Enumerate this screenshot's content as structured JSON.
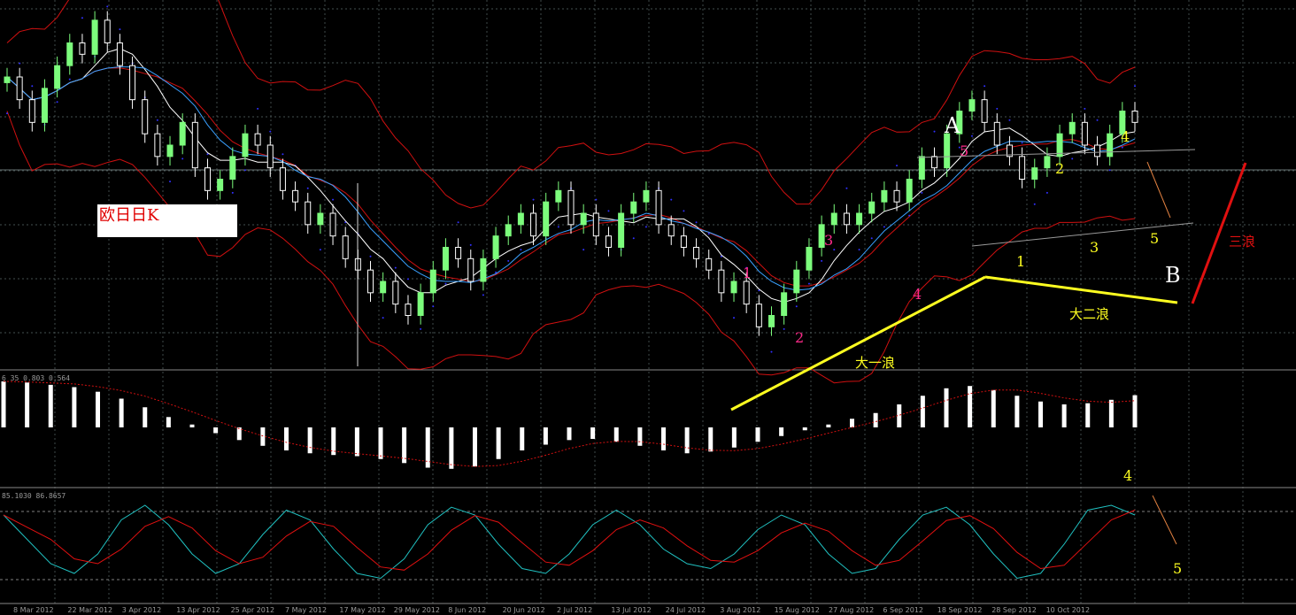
{
  "title_box": "欧日日K",
  "panels": {
    "macd_header": "6 35 0.803 0.564",
    "stoch_header": "85.1030 86.8657"
  },
  "x_dates": [
    "8 Mar 2012",
    "22 Mar 2012",
    "3 Apr 2012",
    "13 Apr 2012",
    "25 Apr 2012",
    "7 May 2012",
    "17 May 2012",
    "29 May 2012",
    "8 Jun 2012",
    "20 Jun 2012",
    "2 Jul 2012",
    "13 Jul 2012",
    "24 Jul 2012",
    "3 Aug 2012",
    "15 Aug 2012",
    "27 Aug 2012",
    "6 Sep 2012",
    "18 Sep 2012",
    "28 Sep 2012",
    "10 Oct 2012"
  ],
  "annotations": {
    "wave_A": "A",
    "wave_B": "B",
    "wave_three": "三浪",
    "big_wave_one": "大一浪",
    "big_wave_two": "大二浪",
    "pink_counts": [
      "1",
      "2",
      "3",
      "4",
      "5"
    ],
    "yellow_counts": [
      "1",
      "2",
      "3",
      "4",
      "5"
    ],
    "stoch_counts": [
      "4",
      "5"
    ]
  },
  "colors": {
    "background": "#000000",
    "grid": "#5a6a6a",
    "candle_bull": "#7cfc7c",
    "candle_bear": "#ffffff",
    "bollinger": "#d01010",
    "sar_dots": "#3030ff",
    "ma_white": "#ffffff",
    "ma_blue": "#3aa0ff",
    "macd_bars": "#ffffff",
    "macd_signal": "#d01010",
    "stoch_main": "#20c0c0",
    "stoch_signal": "#e01010",
    "pink": "#ff2a8a",
    "yellow": "#ffff20",
    "wave_red": "#e01010"
  },
  "chart_data": {
    "type": "candlestick",
    "title": "欧日日K",
    "series": [
      {
        "name": "price",
        "values": [
          108,
          106,
          104,
          107,
          109,
          111,
          110,
          113,
          111,
          109,
          106,
          103,
          101,
          102,
          104,
          100,
          98,
          99,
          101,
          103,
          102,
          100,
          98,
          97,
          95,
          96,
          94,
          92,
          91,
          89,
          90,
          88,
          87,
          89,
          91,
          93,
          92,
          90,
          92,
          94,
          95,
          96,
          94,
          97,
          98,
          95,
          96,
          94,
          93,
          96,
          97,
          98,
          95,
          94,
          93,
          92,
          91,
          89,
          90,
          88,
          86,
          87,
          89,
          91,
          93,
          95,
          96,
          95,
          96,
          97,
          98,
          97,
          99,
          101,
          100,
          103,
          105,
          106,
          104,
          102,
          101,
          99,
          100,
          101,
          103,
          104,
          102,
          101,
          103,
          105,
          104
        ]
      }
    ],
    "macd_values": [
      0.8,
      0.78,
      0.74,
      0.7,
      0.62,
      0.5,
      0.35,
      0.18,
      0.05,
      -0.1,
      -0.22,
      -0.32,
      -0.4,
      -0.45,
      -0.48,
      -0.5,
      -0.55,
      -0.62,
      -0.7,
      -0.72,
      -0.68,
      -0.55,
      -0.4,
      -0.3,
      -0.22,
      -0.2,
      -0.25,
      -0.32,
      -0.4,
      -0.45,
      -0.42,
      -0.35,
      -0.25,
      -0.15,
      -0.05,
      0.05,
      0.15,
      0.25,
      0.4,
      0.55,
      0.68,
      0.72,
      0.65,
      0.55,
      0.45,
      0.4,
      0.42,
      0.48,
      0.56
    ],
    "stoch_values": [
      80,
      55,
      30,
      20,
      40,
      75,
      90,
      70,
      40,
      20,
      30,
      60,
      85,
      75,
      45,
      20,
      15,
      35,
      70,
      88,
      80,
      50,
      25,
      20,
      40,
      70,
      85,
      70,
      45,
      30,
      25,
      40,
      65,
      80,
      70,
      40,
      20,
      25,
      55,
      80,
      88,
      70,
      40,
      15,
      20,
      50,
      85,
      90,
      80
    ]
  }
}
